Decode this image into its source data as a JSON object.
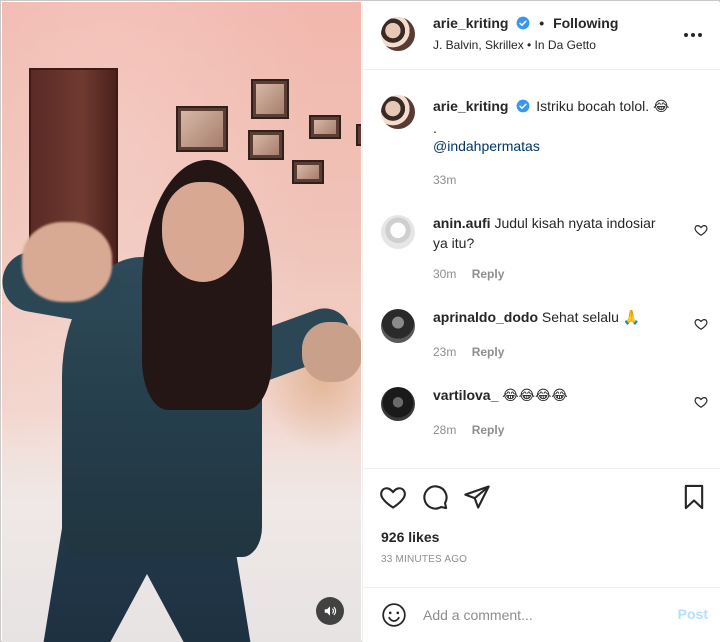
{
  "post": {
    "username": "arie_kriting",
    "follow_separator": "•",
    "follow_status": "Following",
    "audio_info": "J. Balvin, Skrillex • In Da Getto"
  },
  "caption": {
    "username": "arie_kriting",
    "text": "Istriku bocah tolol. 😂",
    "dot": ".",
    "mention": "@indahpermatas",
    "time": "33m"
  },
  "comments": [
    {
      "username": "anin.aufi",
      "text": "Judul kisah nyata indosiar ya itu?",
      "time": "30m",
      "reply": "Reply"
    },
    {
      "username": "aprinaldo_dodo",
      "text": "Sehat selalu 🙏",
      "time": "23m",
      "reply": "Reply"
    },
    {
      "username": "vartilova_",
      "text": "😂😂😂😂",
      "time": "28m",
      "reply": "Reply"
    }
  ],
  "engagement": {
    "likes": "926 likes",
    "time_ago": "33 MINUTES AGO"
  },
  "add_comment": {
    "placeholder": "Add a comment...",
    "post_label": "Post"
  },
  "colors": {
    "verified": "#3897f0",
    "link": "#00376b",
    "muted": "#8e8e8e",
    "post_disabled": "#b2dffc"
  }
}
